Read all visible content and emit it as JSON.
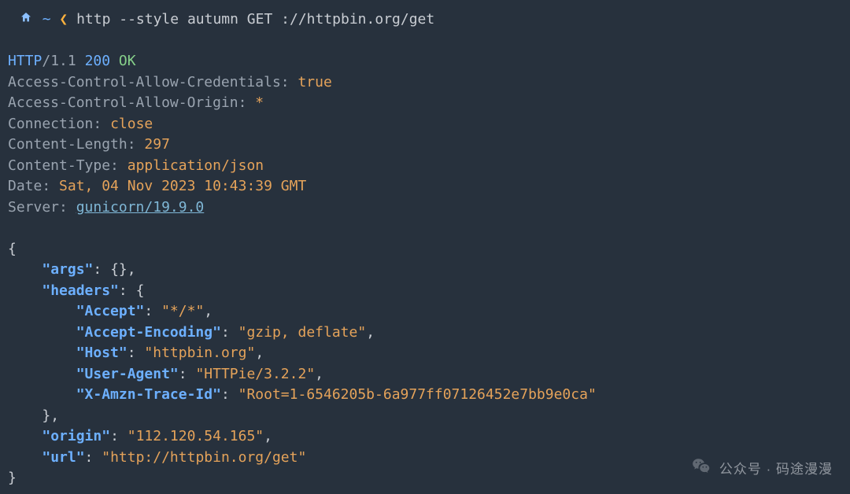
{
  "prompt": {
    "tilde": "~",
    "chevron": "❮",
    "command": "http --style autumn GET ://httpbin.org/get"
  },
  "response": {
    "protocol": "HTTP",
    "version": "/1.1",
    "status_code": "200",
    "status_text": "OK",
    "headers": [
      {
        "name": "Access-Control-Allow-Credentials",
        "value": "true",
        "link": false
      },
      {
        "name": "Access-Control-Allow-Origin",
        "value": "*",
        "link": false
      },
      {
        "name": "Connection",
        "value": "close",
        "link": false
      },
      {
        "name": "Content-Length",
        "value": "297",
        "link": false
      },
      {
        "name": "Content-Type",
        "value": "application/json",
        "link": false
      },
      {
        "name": "Date",
        "value": "Sat, 04 Nov 2023 10:43:39 GMT",
        "link": false
      },
      {
        "name": "Server",
        "value": "gunicorn/19.9.0",
        "link": true
      }
    ]
  },
  "body": {
    "args": {},
    "headers": {
      "Accept": "*/*",
      "Accept-Encoding": "gzip, deflate",
      "Host": "httpbin.org",
      "User-Agent": "HTTPie/3.2.2",
      "X-Amzn-Trace-Id": "Root=1-6546205b-6a977ff07126452e7bb9e0ca"
    },
    "origin": "112.120.54.165",
    "url": "http://httpbin.org/get"
  },
  "watermark": {
    "text": "公众号 · 码途漫漫"
  },
  "colors": {
    "background": "#27313d",
    "blue": "#6db0ff",
    "orange": "#e5a35a",
    "gray": "#9aa4b0",
    "green": "#86d08a",
    "linkblue": "#7fb7d6"
  }
}
